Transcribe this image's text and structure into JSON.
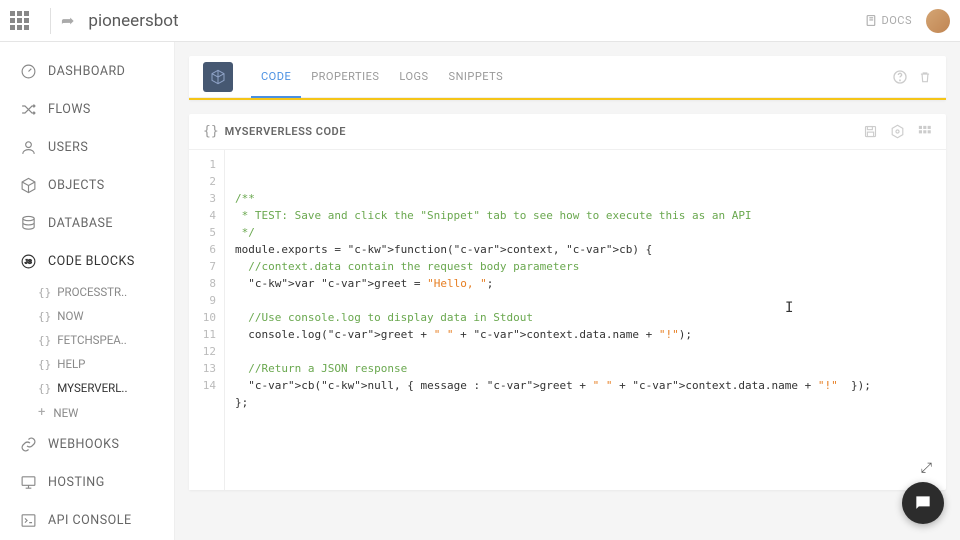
{
  "header": {
    "title": "pioneersbot",
    "docs_label": "DOCS"
  },
  "sidebar": {
    "items": [
      {
        "label": "DASHBOARD",
        "icon": "gauge"
      },
      {
        "label": "FLOWS",
        "icon": "shuffle"
      },
      {
        "label": "USERS",
        "icon": "user"
      },
      {
        "label": "OBJECTS",
        "icon": "cube"
      },
      {
        "label": "DATABASE",
        "icon": "db"
      },
      {
        "label": "CODE BLOCKS",
        "icon": "js",
        "active": true
      },
      {
        "label": "WEBHOOKS",
        "icon": "link"
      },
      {
        "label": "HOSTING",
        "icon": "monitor"
      },
      {
        "label": "API CONSOLE",
        "icon": "terminal"
      }
    ],
    "code_blocks": [
      {
        "label": "PROCESSTR.."
      },
      {
        "label": "NOW"
      },
      {
        "label": "FETCHSPEA.."
      },
      {
        "label": "HELP"
      },
      {
        "label": "MYSERVERL..",
        "active": true
      },
      {
        "label": "NEW",
        "new": true
      }
    ]
  },
  "tabs": [
    {
      "label": "CODE",
      "active": true
    },
    {
      "label": "PROPERTIES"
    },
    {
      "label": "LOGS"
    },
    {
      "label": "SNIPPETS"
    }
  ],
  "code_panel": {
    "title": "MYSERVERLESS CODE"
  },
  "code_lines": [
    {
      "n": 1,
      "t": "com",
      "txt": "/**"
    },
    {
      "n": 2,
      "t": "com",
      "txt": " * TEST: Save and click the \"Snippet\" tab to see how to execute this as an API"
    },
    {
      "n": 3,
      "t": "com",
      "txt": " */"
    },
    {
      "n": 4,
      "t": "raw",
      "txt": "module.exports = function(context, cb) {"
    },
    {
      "n": 5,
      "t": "com",
      "txt": "  //context.data contain the request body parameters"
    },
    {
      "n": 6,
      "t": "raw",
      "txt": "  var greet = \"Hello, \";"
    },
    {
      "n": 7,
      "t": "blank",
      "txt": ""
    },
    {
      "n": 8,
      "t": "com",
      "txt": "  //Use console.log to display data in Stdout"
    },
    {
      "n": 9,
      "t": "raw",
      "txt": "  console.log(greet + \" \" + context.data.name + \"!\");"
    },
    {
      "n": 10,
      "t": "blank",
      "txt": ""
    },
    {
      "n": 11,
      "t": "com",
      "txt": "  //Return a JSON response"
    },
    {
      "n": 12,
      "t": "raw",
      "txt": "  cb(null, { message : greet + \" \" + context.data.name + \"!\"  });"
    },
    {
      "n": 13,
      "t": "raw",
      "txt": "};"
    },
    {
      "n": 14,
      "t": "blank",
      "txt": ""
    }
  ]
}
